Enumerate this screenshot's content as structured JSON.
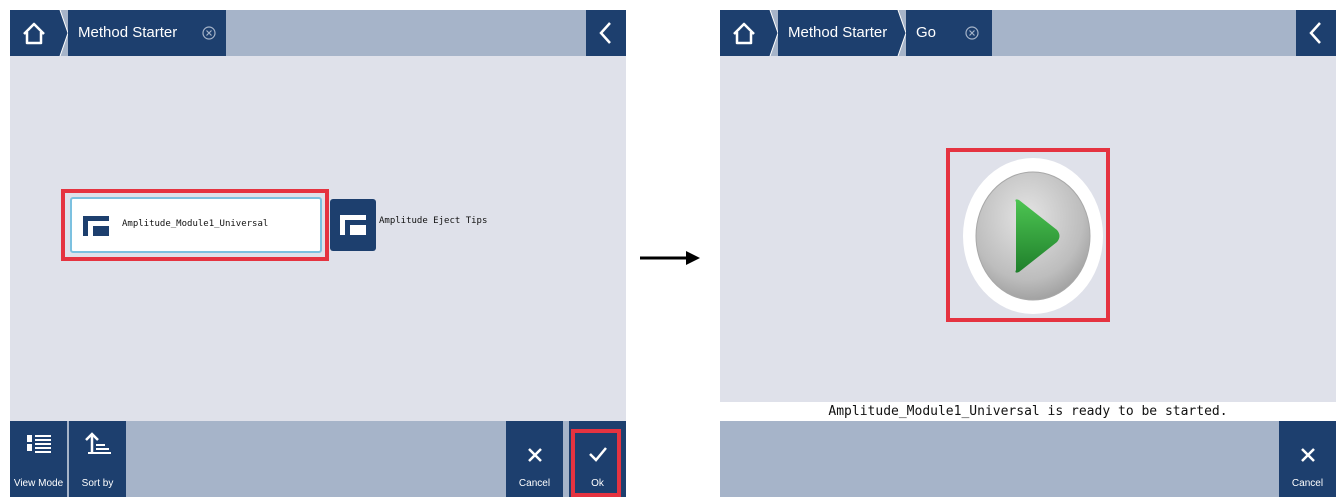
{
  "left": {
    "breadcrumb": {
      "title": "Method Starter"
    },
    "methods": [
      {
        "name": "Amplitude_Module1_Universal",
        "selected": true
      },
      {
        "name": "Amplitude Eject Tips",
        "selected": false
      }
    ],
    "toolbar": {
      "view_mode_label": "View Mode",
      "sort_by_label": "Sort by",
      "cancel_label": "Cancel",
      "ok_label": "Ok"
    }
  },
  "right": {
    "breadcrumb": {
      "title": "Method Starter",
      "sub": "Go"
    },
    "status_message": "Amplitude_Module1_Universal is ready to be started.",
    "toolbar": {
      "cancel_label": "Cancel"
    }
  },
  "colors": {
    "accent": "#1d3f6e",
    "bar": "#a6b4c9",
    "background": "#dfe1ea",
    "highlight": "#e53340",
    "play_green": "#2e9e3a"
  }
}
